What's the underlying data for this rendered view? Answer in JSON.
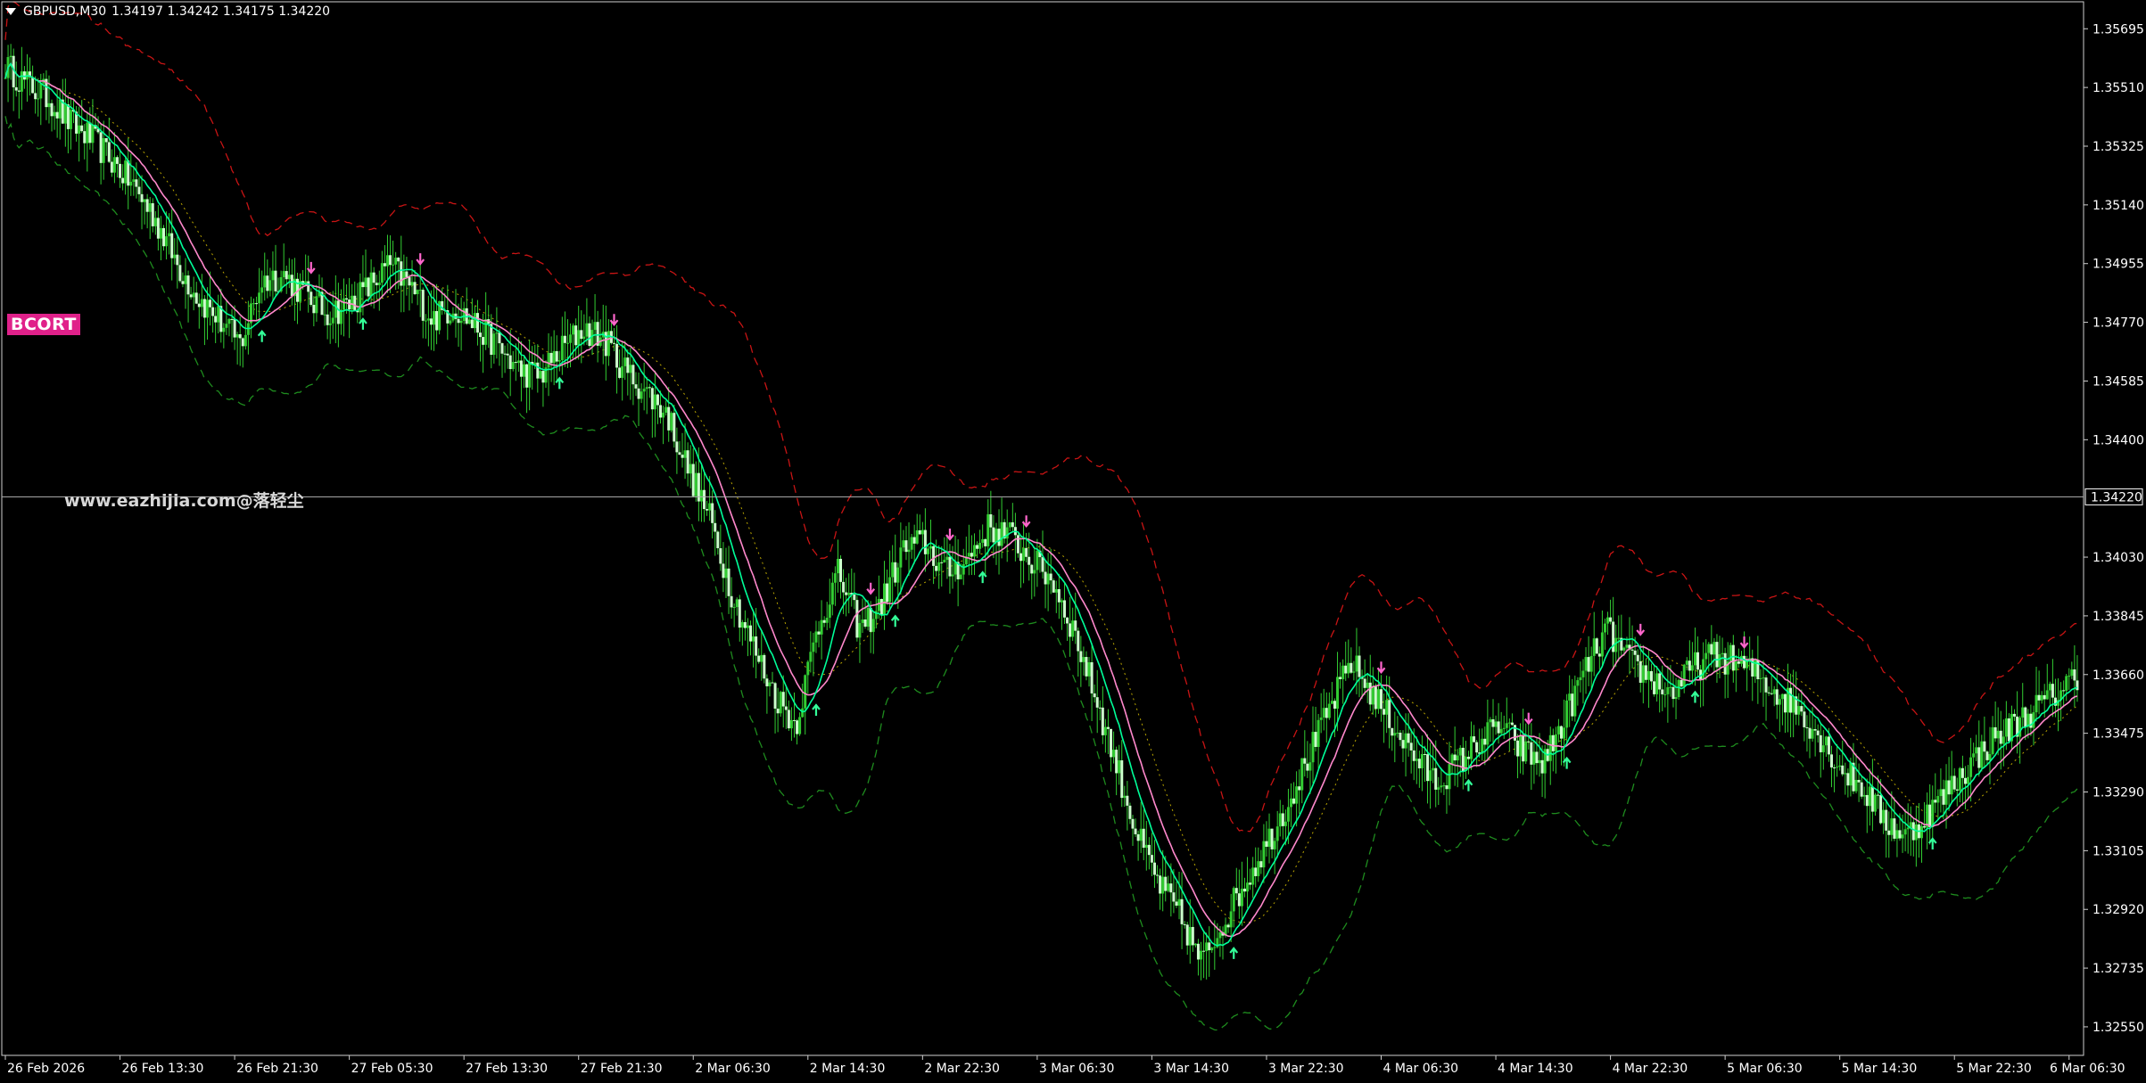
{
  "header": {
    "symbol": "GBPUSD,M30",
    "ohlc": "1.34197 1.34242 1.34175 1.34220"
  },
  "badge": {
    "label": "BCORT"
  },
  "watermark": {
    "text": "www.eazhijia.com@落轻尘"
  },
  "colors": {
    "background": "#000000",
    "candle": "#32cd32",
    "candle_bright": "#ccffcc",
    "upper_band": "#c81414",
    "lower_band": "#1e8c1e",
    "fast_line": "#00ff99",
    "slow_line": "#ff88cc",
    "mid_line": "#b8a400",
    "arrow_up": "#33ff99",
    "arrow_down": "#ff66cc",
    "crosshair": "#b0b0b0"
  },
  "chart_data": {
    "type": "candlestick",
    "symbol": "GBPUSD",
    "timeframe": "M30",
    "ylim": [
      1.3246,
      1.3578
    ],
    "current_price": "1.34220",
    "y_ticks": [
      "1.35695",
      "1.35510",
      "1.35325",
      "1.35140",
      "1.34955",
      "1.34770",
      "1.34585",
      "1.34400",
      "1.34030",
      "1.33845",
      "1.33660",
      "1.33475",
      "1.33290",
      "1.33105",
      "1.32920",
      "1.32735",
      "1.32550"
    ],
    "x_ticks": [
      "26 Feb 2026",
      "26 Feb 13:30",
      "26 Feb 21:30",
      "27 Feb 05:30",
      "27 Feb 13:30",
      "27 Feb 21:30",
      "2 Mar 06:30",
      "2 Mar 14:30",
      "2 Mar 22:30",
      "3 Mar 06:30",
      "3 Mar 14:30",
      "3 Mar 22:30",
      "4 Mar 06:30",
      "4 Mar 14:30",
      "4 Mar 22:30",
      "5 Mar 06:30",
      "5 Mar 14:30",
      "5 Mar 22:30",
      "6 Mar 06:30"
    ],
    "close_path": [
      1.3558,
      1.3552,
      1.3548,
      1.354,
      1.3535,
      1.3528,
      1.352,
      1.351,
      1.3496,
      1.3485,
      1.3478,
      1.347,
      1.349,
      1.3492,
      1.3486,
      1.348,
      1.3482,
      1.3488,
      1.3495,
      1.3488,
      1.3478,
      1.3482,
      1.3476,
      1.347,
      1.3462,
      1.346,
      1.3468,
      1.3475,
      1.3472,
      1.3462,
      1.3455,
      1.3448,
      1.343,
      1.3415,
      1.3392,
      1.3375,
      1.336,
      1.335,
      1.338,
      1.3398,
      1.338,
      1.3388,
      1.3405,
      1.3408,
      1.3398,
      1.3402,
      1.3412,
      1.341,
      1.3402,
      1.3396,
      1.338,
      1.336,
      1.3338,
      1.3315,
      1.33,
      1.329,
      1.3275,
      1.3288,
      1.33,
      1.3312,
      1.3325,
      1.334,
      1.3355,
      1.337,
      1.336,
      1.335,
      1.334,
      1.3332,
      1.3338,
      1.3345,
      1.335,
      1.3342,
      1.3338,
      1.3352,
      1.3368,
      1.338,
      1.337,
      1.3365,
      1.336,
      1.3368,
      1.3372,
      1.337,
      1.3366,
      1.336,
      1.3355,
      1.3346,
      1.3336,
      1.333,
      1.332,
      1.3315,
      1.3322,
      1.333,
      1.3338,
      1.3345,
      1.335,
      1.3355,
      1.336,
      1.3366
    ]
  }
}
